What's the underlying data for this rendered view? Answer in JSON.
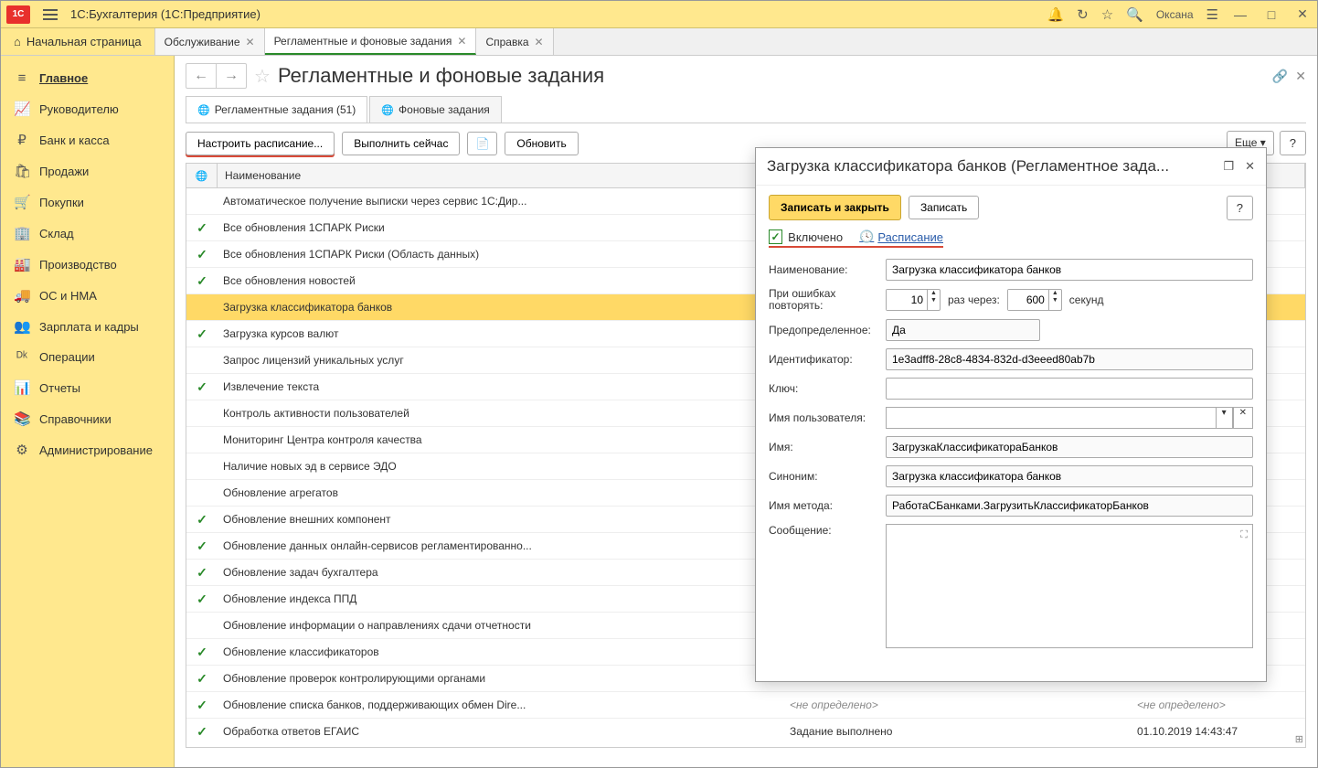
{
  "app": {
    "title": "1С:Бухгалтерия  (1С:Предприятие)",
    "user": "Оксана"
  },
  "tabs": {
    "home": "Начальная страница",
    "items": [
      {
        "label": "Обслуживание",
        "active": false
      },
      {
        "label": "Регламентные и фоновые задания",
        "active": true
      },
      {
        "label": "Справка",
        "active": false
      }
    ]
  },
  "sidebar": [
    {
      "icon": "≡",
      "label": "Главное",
      "active": true
    },
    {
      "icon": "📈",
      "label": "Руководителю"
    },
    {
      "icon": "₽",
      "label": "Банк и касса"
    },
    {
      "icon": "🛍",
      "label": "Продажи"
    },
    {
      "icon": "🛒",
      "label": "Покупки"
    },
    {
      "icon": "🏢",
      "label": "Склад"
    },
    {
      "icon": "🏭",
      "label": "Производство"
    },
    {
      "icon": "🚚",
      "label": "ОС и НМА"
    },
    {
      "icon": "👥",
      "label": "Зарплата и кадры"
    },
    {
      "icon": "ᴰᵏ",
      "label": "Операции"
    },
    {
      "icon": "📊",
      "label": "Отчеты"
    },
    {
      "icon": "📚",
      "label": "Справочники"
    },
    {
      "icon": "⚙",
      "label": "Администрирование"
    }
  ],
  "page": {
    "title": "Регламентные и фоновые задания"
  },
  "subtabs": [
    {
      "label": "Регламентные задания (51)",
      "active": true
    },
    {
      "label": "Фоновые задания",
      "active": false
    }
  ],
  "toolbar": {
    "schedule": "Настроить расписание...",
    "runNow": "Выполнить сейчас",
    "refresh": "Обновить",
    "more": "Еще",
    "help": "?"
  },
  "table": {
    "headers": {
      "name": "Наименование"
    },
    "rows": [
      {
        "check": false,
        "name": "Автоматическое получение выписки через сервис 1С:Дир...",
        "state": "",
        "date": ""
      },
      {
        "check": true,
        "name": "Все обновления 1СПАРК Риски",
        "state": "",
        "date": ""
      },
      {
        "check": true,
        "name": "Все обновления 1СПАРК Риски (Область данных)",
        "state": "",
        "date": ""
      },
      {
        "check": true,
        "name": "Все обновления новостей",
        "state": "",
        "date": ""
      },
      {
        "check": false,
        "name": "Загрузка классификатора банков",
        "selected": true,
        "state": "",
        "date": ""
      },
      {
        "check": true,
        "name": "Загрузка курсов валют",
        "state": "",
        "date": ""
      },
      {
        "check": false,
        "name": "Запрос лицензий уникальных услуг",
        "state": "",
        "date": ""
      },
      {
        "check": true,
        "name": "Извлечение текста",
        "state": "",
        "date": ""
      },
      {
        "check": false,
        "name": "Контроль активности пользователей",
        "state": "",
        "date": ""
      },
      {
        "check": false,
        "name": "Мониторинг Центра контроля качества",
        "state": "",
        "date": ""
      },
      {
        "check": false,
        "name": "Наличие новых эд в сервисе ЭДО",
        "state": "",
        "date": ""
      },
      {
        "check": false,
        "name": "Обновление агрегатов",
        "state": "",
        "date": ""
      },
      {
        "check": true,
        "name": "Обновление внешних компонент",
        "state": "",
        "date": ""
      },
      {
        "check": true,
        "name": "Обновление данных онлайн-сервисов регламентированно...",
        "state": "",
        "date": ""
      },
      {
        "check": true,
        "name": "Обновление задач бухгалтера",
        "state": "",
        "date": ""
      },
      {
        "check": true,
        "name": "Обновление индекса ППД",
        "state": "",
        "date": ""
      },
      {
        "check": false,
        "name": "Обновление информации о направлениях сдачи отчетности",
        "state": "",
        "date": ""
      },
      {
        "check": true,
        "name": "Обновление классификаторов",
        "state": "",
        "date": ""
      },
      {
        "check": true,
        "name": "Обновление проверок контролирующими органами",
        "state": "",
        "date": ""
      },
      {
        "check": true,
        "name": "Обновление списка банков, поддерживающих обмен Dire...",
        "state": "<не определено>",
        "date": "<не определено>"
      },
      {
        "check": true,
        "name": "Обработка ответов ЕГАИС",
        "state": "Задание выполнено",
        "stateNormal": true,
        "date": "01.10.2019 14:43:47",
        "dateNormal": true
      }
    ]
  },
  "dialog": {
    "title": "Загрузка классификатора банков (Регламентное зада...",
    "saveClose": "Записать и закрыть",
    "save": "Записать",
    "help": "?",
    "enabled": "Включено",
    "scheduleLink": "Расписание",
    "labels": {
      "name": "Наименование:",
      "retry": "При ошибках повторять:",
      "retryTimes": "раз  через:",
      "seconds": "секунд",
      "predefined": "Предопределенное:",
      "id": "Идентификатор:",
      "key": "Ключ:",
      "username": "Имя пользователя:",
      "intName": "Имя:",
      "synonym": "Синоним:",
      "method": "Имя метода:",
      "message": "Сообщение:"
    },
    "values": {
      "name": "Загрузка классификатора банков",
      "retryCount": "10",
      "retryInterval": "600",
      "predefined": "Да",
      "id": "1e3adff8-28c8-4834-832d-d3eeed80ab7b",
      "key": "",
      "username": "",
      "intName": "ЗагрузкаКлассификатораБанков",
      "synonym": "Загрузка классификатора банков",
      "method": "РаботаСБанками.ЗагрузитьКлассификаторБанков",
      "message": ""
    }
  }
}
